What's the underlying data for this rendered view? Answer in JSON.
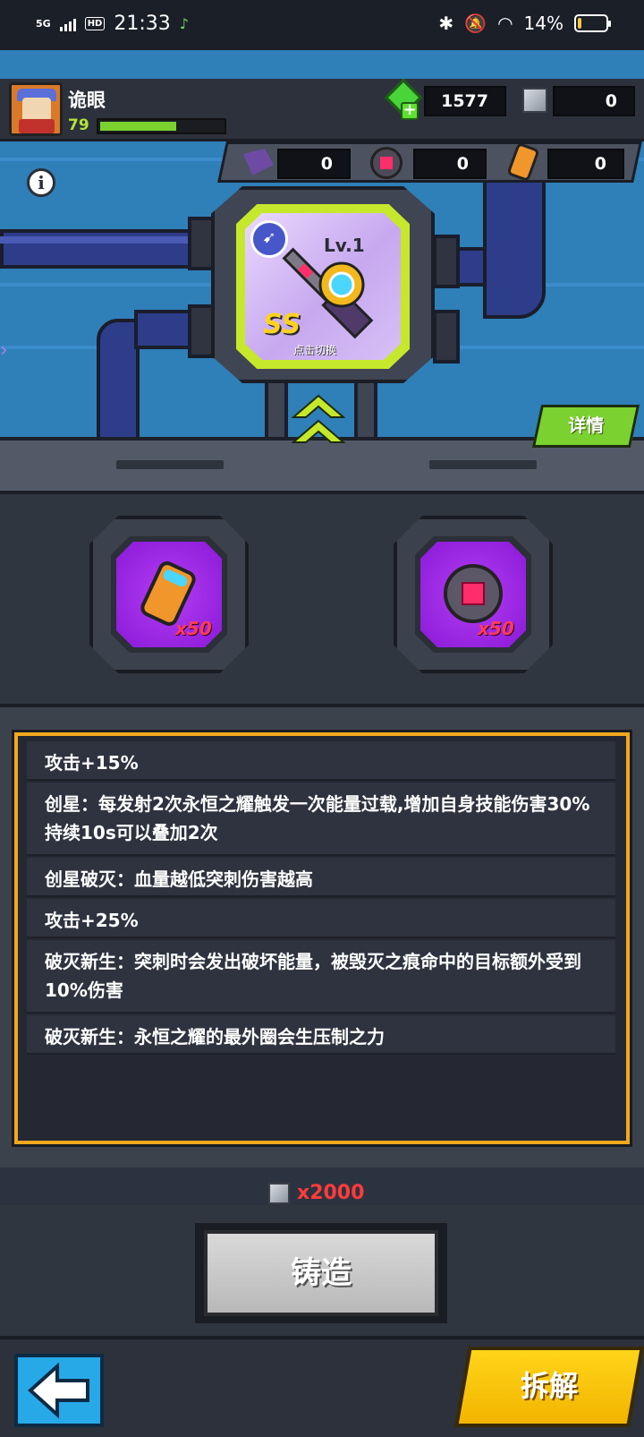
{
  "status_bar": {
    "network": "5G",
    "hd": "HD",
    "time": "21:33",
    "battery": "14%",
    "battery_level": 0.14
  },
  "player": {
    "name": "诡眼",
    "level": "79",
    "xp_fraction": 0.6
  },
  "resources": {
    "gems": "1577",
    "cubes": "0",
    "shards": "0",
    "cores": "0",
    "cylinders": "0"
  },
  "weapon": {
    "level": "Lv.1",
    "rank": "SS",
    "switch_hint": "点击切换"
  },
  "buttons": {
    "details": "详情",
    "forge": "铸造",
    "dismantle": "拆解"
  },
  "materials": [
    {
      "icon": "cylinder-icon",
      "count": "x50"
    },
    {
      "icon": "core-icon",
      "count": "x50"
    }
  ],
  "effects": [
    "攻击+15%",
    "创星：每发射2次永恒之耀触发一次能量过载,增加自身技能伤害30%持续10s可以叠加2次",
    "创星破灭：血量越低突刺伤害越高",
    "攻击+25%",
    "破灭新生：突刺时会发出破坏能量，被毁灭之痕命中的目标额外受到10%伤害",
    "破灭新生：永恒之耀的最外圈会生压制之力"
  ],
  "forge_cost": "x2000",
  "colors": {
    "accent_green": "#7bd12f",
    "panel_border": "#f2a81d",
    "dismantle": "#ffd51a",
    "cost_red": "#ff3b3b"
  }
}
